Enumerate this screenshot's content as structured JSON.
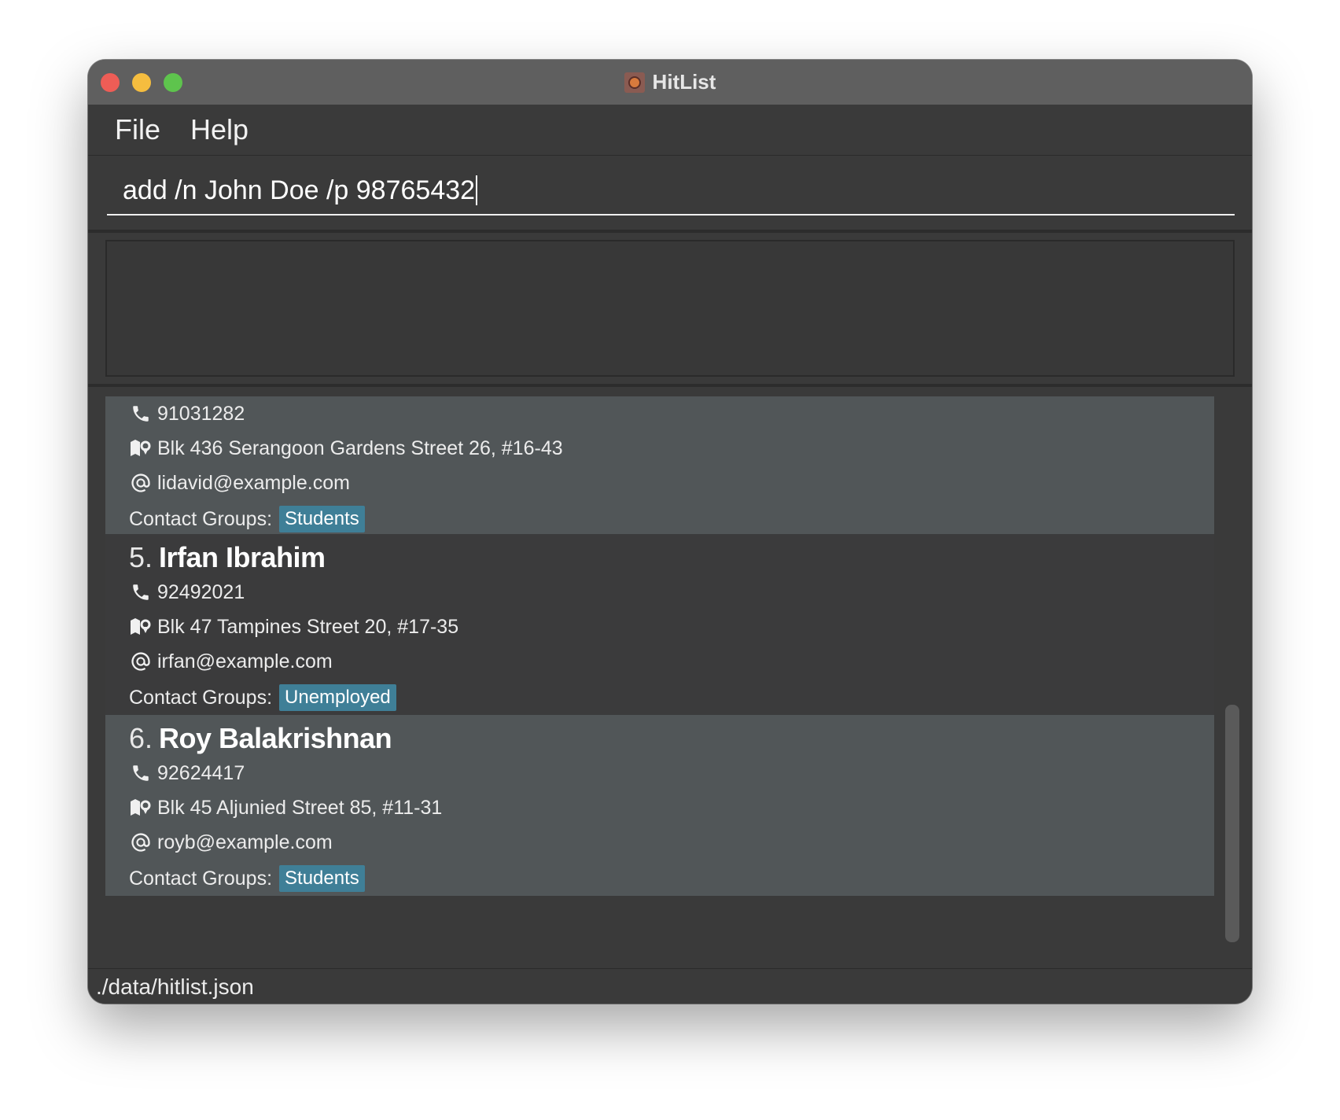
{
  "window": {
    "title": "HitList",
    "app_icon": "hitlist-app-icon"
  },
  "menu": {
    "items": [
      "File",
      "Help"
    ]
  },
  "command": {
    "value": "add /n John Doe /p 98765432"
  },
  "result_display": {
    "text": ""
  },
  "contacts": {
    "partial": {
      "phone": "91031282",
      "address": "Blk 436 Serangoon Gardens Street 26, #16-43",
      "email": "lidavid@example.com",
      "groups_label": "Contact Groups:",
      "groups": [
        "Students"
      ]
    },
    "items": [
      {
        "index": "5.",
        "name": "Irfan Ibrahim",
        "phone": "92492021",
        "address": "Blk 47 Tampines Street 20, #17-35",
        "email": "irfan@example.com",
        "groups_label": "Contact Groups:",
        "groups": [
          "Unemployed"
        ]
      },
      {
        "index": "6.",
        "name": "Roy Balakrishnan",
        "phone": "92624417",
        "address": "Blk 45 Aljunied Street 85, #11-31",
        "email": "royb@example.com",
        "groups_label": "Contact Groups:",
        "groups": [
          "Students"
        ]
      }
    ]
  },
  "status": {
    "file_path": "./data/hitlist.json"
  },
  "icons": {
    "phone": "phone-icon",
    "address": "map-marker-icon",
    "email": "at-icon"
  },
  "colors": {
    "tag_bg": "#3f7f97",
    "card_alt": "#515658",
    "window_bg": "#3a3a3a"
  }
}
